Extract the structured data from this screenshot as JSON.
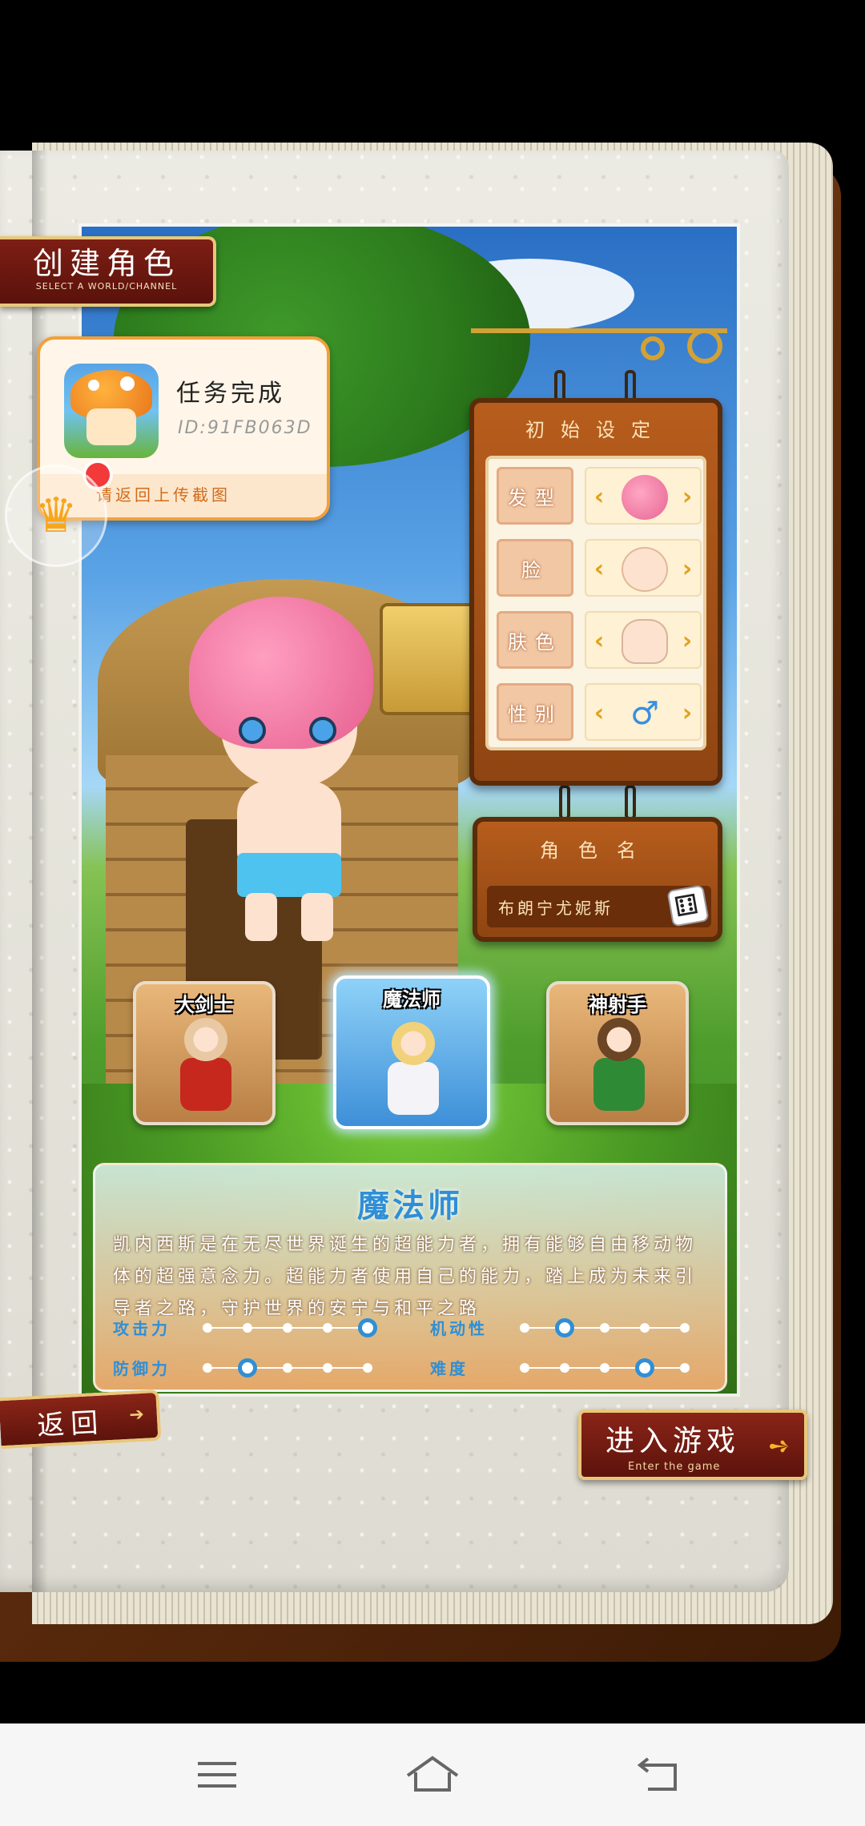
{
  "header": {
    "title": "创建角色",
    "subtitle": "SELECT A WORLD/CHANNEL"
  },
  "task_popup": {
    "title": "任务完成",
    "id": "ID:91FB063D",
    "hint": "请返回上传截图",
    "app_icon": "mushroom-app-icon"
  },
  "crown_button": {
    "icon": "crown-icon"
  },
  "appearance": {
    "title": "初始设定",
    "options": [
      {
        "label": "发型",
        "preview": "hair-preview-icon"
      },
      {
        "label": "脸",
        "preview": "face-preview-icon"
      },
      {
        "label": "肤色",
        "preview": "skin-preview-icon"
      },
      {
        "label": "性别",
        "preview": "male-gender-icon",
        "glyph": "♂"
      }
    ],
    "arrow_left": "‹",
    "arrow_right": "›"
  },
  "name_board": {
    "title": "角色名",
    "value": "布朗宁尤妮斯",
    "dice_icon": "dice-icon",
    "dice_glyph": "⚅"
  },
  "classes": [
    {
      "name": "大剑士",
      "selected": false
    },
    {
      "name": "魔法师",
      "selected": true
    },
    {
      "name": "神射手",
      "selected": false
    }
  ],
  "description": {
    "title": "魔法师",
    "text": "凯内西斯是在无尽世界诞生的超能力者，拥有能够自由移动物体的超强意念力。超能力者使用自己的能力，踏上成为未来引导者之路，守护世界的安宁与和平之路",
    "stats": [
      {
        "label": "攻击力",
        "level": 5,
        "max": 5
      },
      {
        "label": "机动性",
        "level": 2,
        "max": 5
      },
      {
        "label": "防御力",
        "level": 2,
        "max": 5
      },
      {
        "label": "难度",
        "level": 4,
        "max": 5
      }
    ]
  },
  "buttons": {
    "back": "返回",
    "back_arrow": "➔",
    "enter": "进入游戏",
    "enter_sub": "Enter the game",
    "enter_icon": "➺"
  },
  "nav_bar": {
    "menu_icon": "menu-icon",
    "home_icon": "home-icon",
    "back_icon": "back-icon"
  },
  "colors": {
    "accent_red": "#7d1e14",
    "board_wood": "#b75d1d",
    "gold": "#e9c77a",
    "skill_blue": "#2f8fd6"
  }
}
